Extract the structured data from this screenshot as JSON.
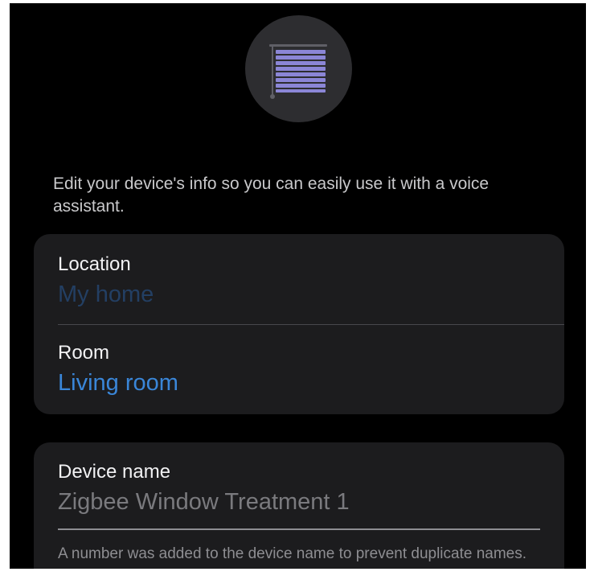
{
  "header": {
    "icon": "window-blinds-icon",
    "icon_color": "#8b86d6"
  },
  "intro_text": "Edit your device's info so you can easily use it with a voice assistant.",
  "location_card": {
    "location_label": "Location",
    "location_value": "My home",
    "room_label": "Room",
    "room_value": "Living room"
  },
  "name_card": {
    "label": "Device name",
    "value": "Zigbee Window Treatment 1",
    "hint": "A number was added to the device name to prevent duplicate names."
  },
  "colors": {
    "background": "#000000",
    "card": "#1c1c1e",
    "accent_link": "#3a86d8",
    "disabled_link": "#233f63"
  }
}
